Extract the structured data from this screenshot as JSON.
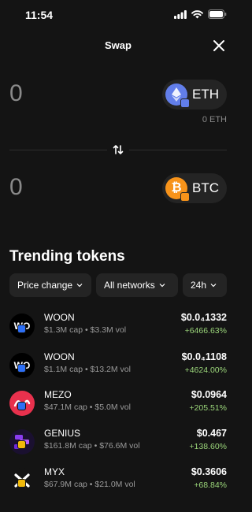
{
  "status": {
    "time": "11:54"
  },
  "header": {
    "title": "Swap",
    "close_icon": "close-icon"
  },
  "from": {
    "amount": "0",
    "token": "ETH",
    "balance": "0 ETH",
    "color": "#627eea"
  },
  "to": {
    "amount": "0",
    "token": "BTC",
    "color": "#f7931a"
  },
  "trending": {
    "title": "Trending tokens",
    "filters": {
      "price_change": "Price change",
      "networks": "All networks",
      "timeframe": "24h"
    },
    "tokens": [
      {
        "name": "WOON",
        "avatar_text": "WO",
        "sub": "$1.3M cap • $3.3M vol",
        "price": "$0.0₄1332",
        "change": "+6466.63%",
        "chain_color": "#2d6ff5"
      },
      {
        "name": "WOON",
        "avatar_text": "WO",
        "sub": "$1.1M cap • $13.2M vol",
        "price": "$0.0₄1108",
        "change": "+4624.00%",
        "chain_color": "#2d6ff5"
      },
      {
        "name": "MEZO",
        "avatar_text": "",
        "sub": "$47.1M cap • $5.0M vol",
        "price": "$0.0964",
        "change": "+205.51%",
        "chain_color": "#2d6ff5"
      },
      {
        "name": "GENIUS",
        "avatar_text": "",
        "sub": "$161.8M cap • $76.6M vol",
        "price": "$0.467",
        "change": "+138.60%",
        "chain_color": "#f0b90b"
      },
      {
        "name": "MYX",
        "avatar_text": "",
        "sub": "$67.9M cap • $21.0M vol",
        "price": "$0.3606",
        "change": "+68.84%",
        "chain_color": "#f0b90b"
      }
    ]
  },
  "colors": {
    "background": "#141414",
    "positive": "#9bd67a",
    "pill": "#242424"
  }
}
